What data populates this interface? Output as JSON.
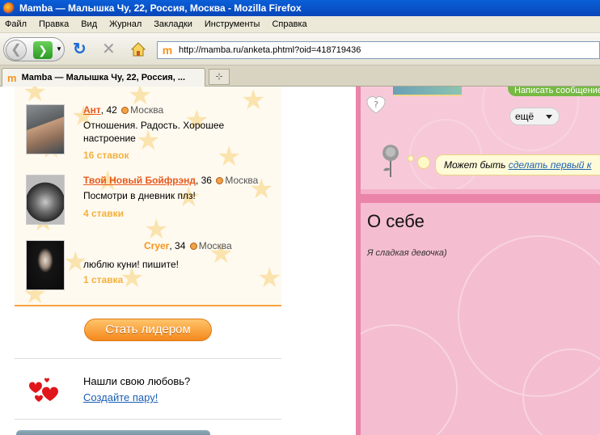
{
  "window": {
    "title": "Mamba — Малышка Чу, 22, Россия, Москва - Mozilla Firefox"
  },
  "menu": [
    "Файл",
    "Правка",
    "Вид",
    "Журнал",
    "Закладки",
    "Инструменты",
    "Справка"
  ],
  "urlbar": {
    "url": "http://mamba.ru/anketa.phtml?oid=418719436",
    "favicon": "m"
  },
  "tab": {
    "title": "Mamba — Малышка Чу, 22, Россия, ...",
    "new_tab_icon": "⊹"
  },
  "leaders": [
    {
      "name": "Ант",
      "age": ", 42",
      "city": "Москва",
      "status": "Отношения. Радость. Хорошее настроение",
      "bids": "16 ставок",
      "linked": true
    },
    {
      "name": "Твой Новый Бойфрэнд",
      "age": ", 36",
      "city": "Москва",
      "status": "Посмотри в дневник плз!",
      "bids": "4 ставки",
      "linked": true
    },
    {
      "name": "Cryer",
      "age": ", 34",
      "city": "Москва",
      "status": "люблю куни! пишите!",
      "bids": "1 ставка",
      "linked": false
    }
  ],
  "leader_button": "Стать лидером",
  "love": {
    "question": "Нашли свою любовь?",
    "link": "Создайте пару!"
  },
  "right": {
    "top_button": "Написать сообщение",
    "more_button": "ещё",
    "bubble_text": "Может быть ",
    "bubble_link": "сделать первый к",
    "about_title": "О себе",
    "about_text": "Я сладкая девочка)"
  },
  "colors": {
    "accent_orange": "#f7941d",
    "link_blue": "#1a5fb4",
    "pink": "#ea84a9",
    "green": "#76b943"
  }
}
